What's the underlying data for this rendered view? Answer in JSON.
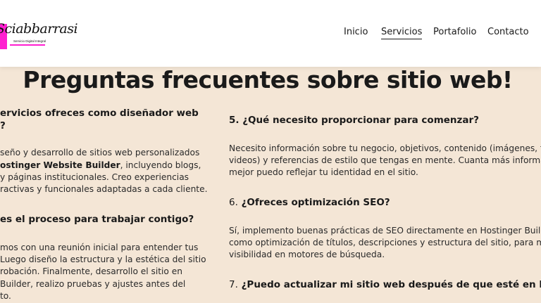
{
  "header": {
    "logo": {
      "script_text": "Sciabbarrasi",
      "tagline": "Servicio Digital Integral"
    },
    "nav": [
      {
        "label": "Inicio",
        "active": false
      },
      {
        "label": "Servicios",
        "active": true
      },
      {
        "label": "Portafolio",
        "active": false
      },
      {
        "label": "Contacto",
        "active": false
      }
    ]
  },
  "main": {
    "title": "Preguntas frecuentes sobre sitio web!",
    "left_column": {
      "q1_line1": "ervicios ofreces como diseñador web",
      "q1_line2": "?",
      "a1_line1": "seño y desarrollo de sitios web personalizados",
      "a1_line2_bold": "ostinger Website Builder",
      "a1_line2_rest": ", incluyendo blogs,",
      "a1_line3": "y páginas institucionales. Creo experiencias",
      "a1_line4": "ractivas y funcionales adaptadas a cada cliente.",
      "q2": "es el proceso para trabajar contigo?",
      "a2_line1": "mos con una reunión inicial para entender tus",
      "a2_line2": "Luego diseño la estructura y la estética del sitio",
      "a2_line3": "robación. Finalmente, desarrollo el sitio en",
      "a2_line4": "Builder, realizo pruebas y ajustes antes del",
      "a2_line5": "to."
    },
    "right_column": {
      "q5": "5. ¿Qué necesito proporcionar para comenzar?",
      "a5_line1": "Necesito información sobre tu negocio, objetivos, contenido (imágenes, texto",
      "a5_line2": "videos) y referencias de estilo que tengas en mente. Cuanta más información",
      "a5_line3": "mejor puedo reflejar tu identidad en el sitio.",
      "q6_number": "6.",
      "q6_text": "¿Ofreces optimización SEO?",
      "a6_line1": "Sí, implemento buenas prácticas de SEO directamente en Hostinger Builder,",
      "a6_line2": "como optimización de títulos, descripciones y estructura del sitio, para mejora",
      "a6_line3": "visibilidad en motores de búsqueda.",
      "q7_number": "7.",
      "q7_text": "¿Puedo actualizar mi sitio web después de que esté en línea?"
    }
  },
  "colors": {
    "background": "#f4e6d6",
    "header_background": "#ffffff",
    "brand_accent": "#ff1fd0",
    "text": "#1a1a1a"
  }
}
